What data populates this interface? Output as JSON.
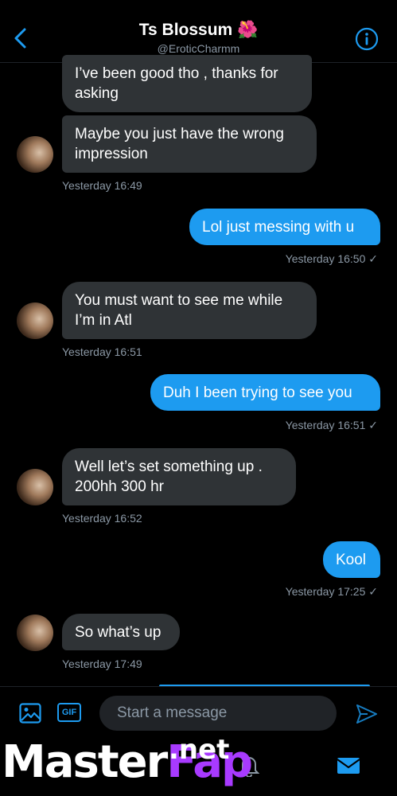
{
  "header": {
    "title": "Ts Blossum 🌺",
    "handle": "@EroticCharmm"
  },
  "messages": [
    {
      "text": "I’ve been good tho , thanks for\nasking"
    },
    {
      "text": "Maybe you just have the wrong\nimpression",
      "time": "Yesterday 16:49"
    },
    {
      "text": "Lol just messing with u",
      "time": "Yesterday 16:50 ✓"
    },
    {
      "text": "You must want to see me while\nI’m in Atl",
      "time": "Yesterday 16:51"
    },
    {
      "text": "Duh I been trying to see you",
      "time": "Yesterday 16:51 ✓"
    },
    {
      "text": "Well let’s set something up .\n200hh 300 hr",
      "time": "Yesterday 16:52"
    },
    {
      "text": "Kool",
      "time": "Yesterday 17:25 ✓"
    },
    {
      "text": "So what’s up",
      "time": "Yesterday 17:49"
    }
  ],
  "composer": {
    "placeholder": "Start a message",
    "gif_label": "GIF"
  },
  "watermark": {
    "master": "Master",
    "fap": "Fap",
    "net": ".net"
  },
  "colors": {
    "accent": "#1d9bf0",
    "incoming_bubble": "#2f3336",
    "secondary_text": "#8b98a5",
    "background": "#000000"
  },
  "icons": [
    "back-chevron-icon",
    "info-icon",
    "image-icon",
    "gif-icon",
    "send-icon",
    "bell-icon",
    "mail-icon"
  ]
}
